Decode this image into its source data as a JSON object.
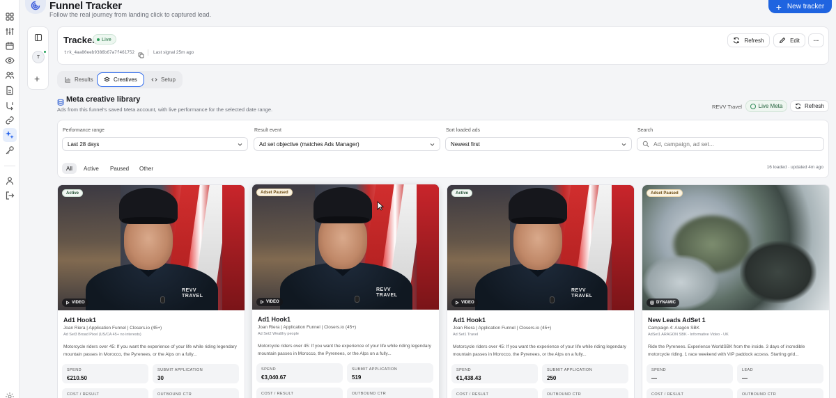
{
  "app": {
    "title": "Funnel Tracker",
    "subtitle": "Follow the real journey from landing click to captured lead.",
    "new_button": "New tracker"
  },
  "rail": {
    "icons": [
      "grid-icon",
      "sliders-icon",
      "calendar-icon",
      "eye-icon",
      "users-icon",
      "document-icon",
      "flow-icon",
      "link-icon",
      "sparkle-icon",
      "key-icon",
      "user-icon",
      "logout-icon"
    ],
    "active": "sparkle-icon"
  },
  "side_panel": {
    "avatar_initial": "T"
  },
  "tracker": {
    "name": "Tracker",
    "status": "Live",
    "id": "trk_4aa80eeb9386b67a7f461752",
    "last_signal": "Last signal 25m ago",
    "refresh_label": "Refresh",
    "edit_label": "Edit",
    "more_label": "···"
  },
  "tabs": [
    {
      "label": "Results",
      "active": false
    },
    {
      "label": "Creatives",
      "active": true
    },
    {
      "label": "Setup",
      "active": false
    }
  ],
  "library": {
    "title": "Meta creative library",
    "subtitle": "Ads from this funnel's saved Meta account, with live performance for the selected date range.",
    "account": "REVV Travel",
    "live_meta_label": "Live Meta",
    "refresh_label": "Refresh"
  },
  "filters": {
    "performance_range": {
      "label": "Performance range",
      "value": "Last 28 days"
    },
    "result_event": {
      "label": "Result event",
      "value": "Ad set objective (matches Ads Manager)"
    },
    "sort": {
      "label": "Sort loaded ads",
      "value": "Newest first"
    },
    "search": {
      "label": "Search",
      "placeholder": "Ad, campaign, ad set..."
    },
    "chips": [
      {
        "label": "All",
        "active": true
      },
      {
        "label": "Active",
        "active": false
      },
      {
        "label": "Paused",
        "active": false
      },
      {
        "label": "Other",
        "active": false
      }
    ],
    "loaded_info": "16 loaded · updated 4m ago"
  },
  "cards": [
    {
      "status": "Active",
      "media": "VIDEO",
      "title": "Ad1 Hook1",
      "campaign": "Joan Riera | Application Funnel | Closers.io (45+)",
      "adset": "Ad Set3 Broad Pixel (US/CA 45+ no interests)",
      "description": "Motorcycle riders over 45: If you want the experience of your life while riding legendary mountain passes in Morocco, the Pyrenees, or the Alps on a fully...",
      "stats": [
        {
          "label": "SPEND",
          "value": "€210.50"
        },
        {
          "label": "SUBMIT APPLICATION",
          "value": "30"
        },
        {
          "label": "COST / RESULT",
          "value": ""
        },
        {
          "label": "OUTBOUND CTR",
          "value": ""
        }
      ]
    },
    {
      "status": "Adset Paused",
      "media": "VIDEO",
      "title": "Ad1 Hook1",
      "campaign": "Joan Riera | Application Funnel | Closers.io (45+)",
      "adset": "Ad Set2 Wealthy people",
      "description": "Motorcycle riders over 45: If you want the experience of your life while riding legendary mountain passes in Morocco, the Pyrenees, or the Alps on a fully...",
      "stats": [
        {
          "label": "SPEND",
          "value": "€3,040.67"
        },
        {
          "label": "SUBMIT APPLICATION",
          "value": "519"
        },
        {
          "label": "COST / RESULT",
          "value": ""
        },
        {
          "label": "OUTBOUND CTR",
          "value": ""
        }
      ]
    },
    {
      "status": "Active",
      "media": "VIDEO",
      "title": "Ad1 Hook1",
      "campaign": "Joan Riera | Application Funnel | Closers.io (45+)",
      "adset": "Ad Set1 Travel",
      "description": "Motorcycle riders over 45: If you want the experience of your life while riding legendary mountain passes in Morocco, the Pyrenees, or the Alps on a fully...",
      "stats": [
        {
          "label": "SPEND",
          "value": "€1,438.43"
        },
        {
          "label": "SUBMIT APPLICATION",
          "value": "250"
        },
        {
          "label": "COST / RESULT",
          "value": ""
        },
        {
          "label": "OUTBOUND CTR",
          "value": ""
        }
      ]
    },
    {
      "status": "Adset Paused",
      "media": "DYNAMIC",
      "title": "New Leads AdSet 1",
      "campaign": "Campaign 4: Aragón SBK",
      "adset": "AdSet1 ARAGON SBK - Informative Video - UK",
      "description": "Ride the Pyrenees. Experience WorldSBK from the inside. 3 days of incredible motorcycle riding. 1 race weekend with VIP paddock access. Starting grid...",
      "stats": [
        {
          "label": "SPEND",
          "value": "—"
        },
        {
          "label": "LEAD",
          "value": "—"
        },
        {
          "label": "COST / RESULT",
          "value": ""
        },
        {
          "label": "OUTBOUND CTR",
          "value": ""
        }
      ]
    }
  ],
  "colors": {
    "accent": "#1f64e0",
    "live_green": "#2e9b5a",
    "paused_badge": "#fbf3e2"
  }
}
